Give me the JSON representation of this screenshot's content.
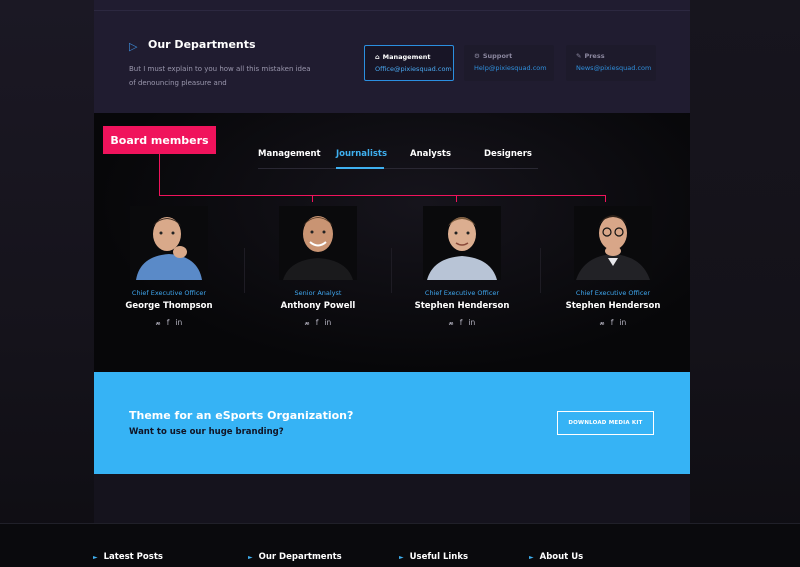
{
  "departments": {
    "title": "Our Departments",
    "description": "But I must explain to you how all this mistaken idea of denouncing pleasure and",
    "contacts": [
      {
        "label": "Management",
        "email": "Office@pixiesquad.com",
        "icon": "home-icon",
        "active": true
      },
      {
        "label": "Support",
        "email": "Help@pixiesquad.com",
        "icon": "gear-icon",
        "active": false
      },
      {
        "label": "Press",
        "email": "News@pixiesquad.com",
        "icon": "pencil-icon",
        "active": false
      }
    ]
  },
  "board": {
    "badge": "Board members",
    "tabs": [
      "Management",
      "Journalists",
      "Analysts",
      "Designers"
    ],
    "active_tab": "Journalists",
    "members": [
      {
        "role": "Chief Executive Officer",
        "name": "George Thompson",
        "shirt": "#5a8ac8"
      },
      {
        "role": "Senior Analyst",
        "name": "Anthony Powell",
        "shirt": "#1a1a1c"
      },
      {
        "role": "Chief Executive Officer",
        "name": "Stephen Henderson",
        "shirt": "#b8c4d6"
      },
      {
        "role": "Chief Executive Officer",
        "name": "Stephen Henderson",
        "shirt": "#222226"
      }
    ],
    "social_icons": [
      "twitter-icon",
      "facebook-icon",
      "linkedin-icon"
    ]
  },
  "cta": {
    "title": "Theme for an eSports Organization?",
    "subtitle": "Want to use our huge branding?",
    "button": "DOWNLOAD MEDIA KIT"
  },
  "footer": {
    "columns": [
      "Latest Posts",
      "Our Departments",
      "Useful Links",
      "About Us"
    ]
  },
  "colors": {
    "accent_pink": "#f0135c",
    "accent_blue": "#3fb0f0",
    "cta_bg": "#36b3f5"
  }
}
